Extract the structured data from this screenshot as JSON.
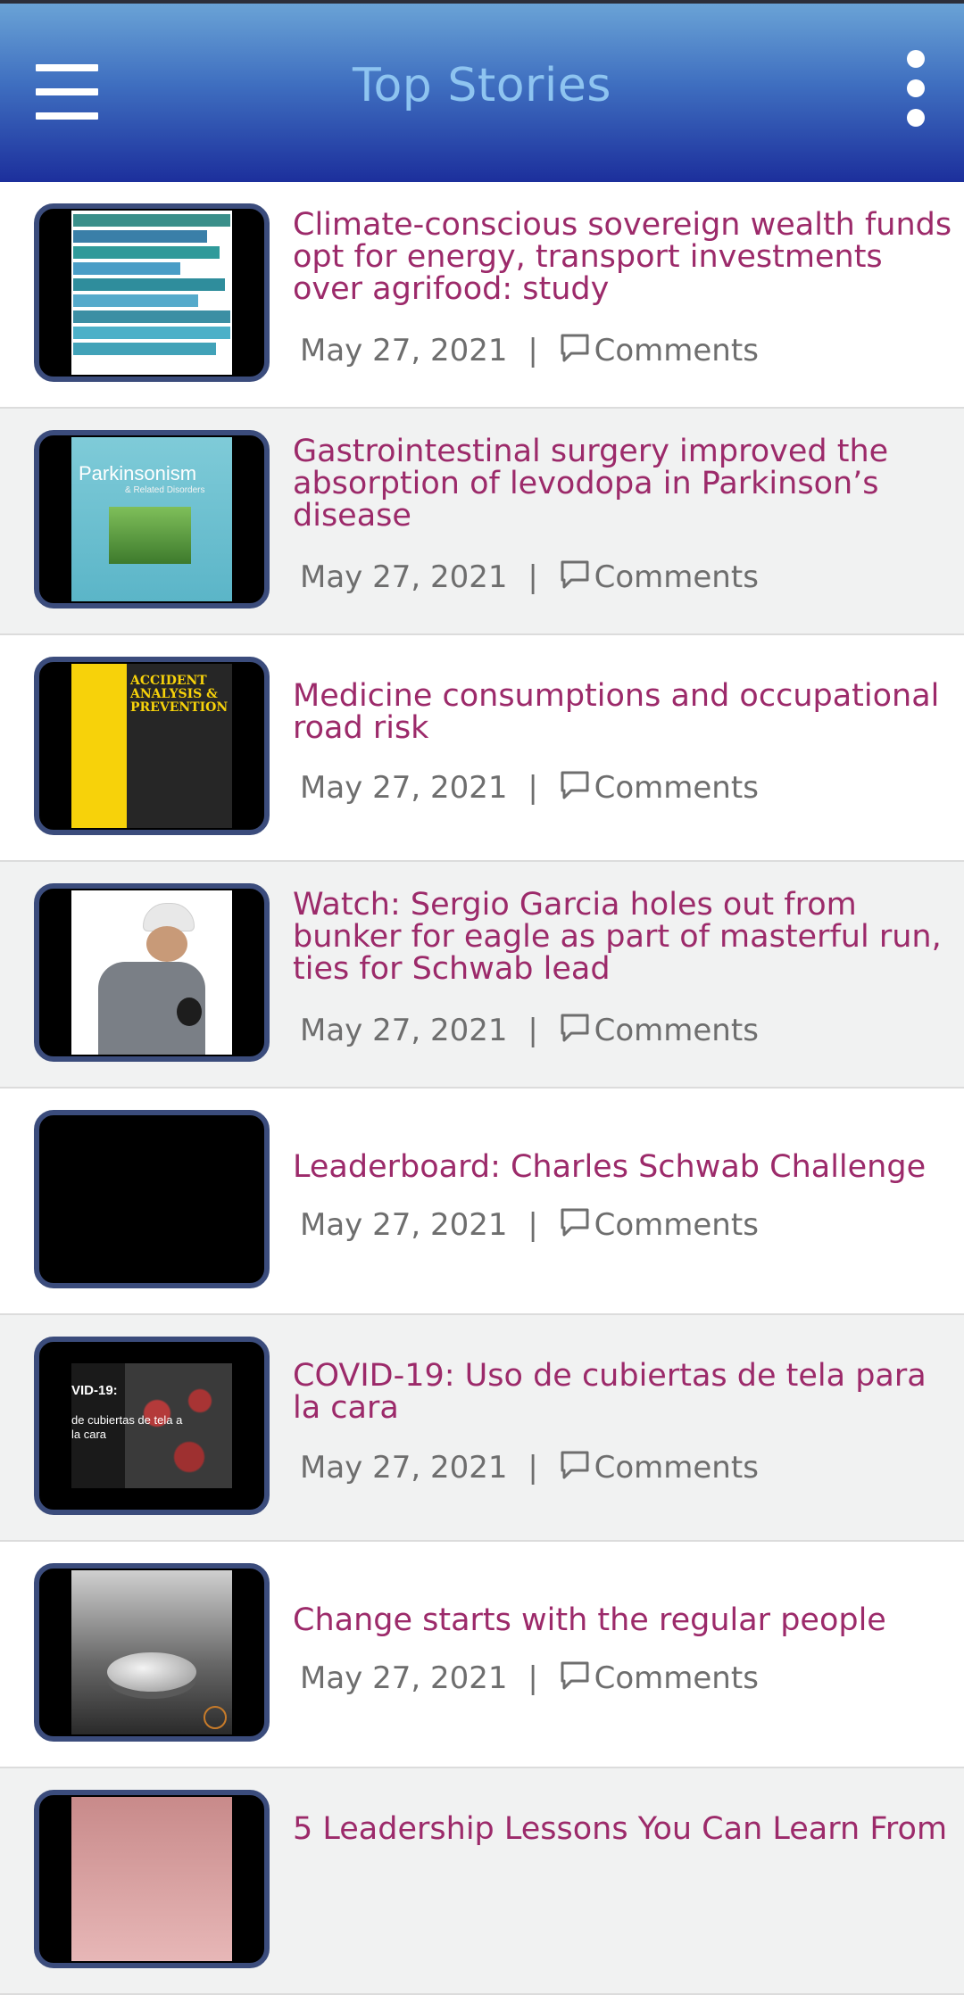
{
  "app_bar": {
    "title": "Top Stories",
    "menu_icon": "hamburger-menu-icon",
    "more_icon": "more-vertical-icon",
    "gradient_top": "#6aa3d6",
    "gradient_bottom": "#1c2f9c",
    "title_color": "#8ec4f0"
  },
  "colors": {
    "title_text": "#9c2a6a",
    "meta_text": "#6e6e6e",
    "thumb_border": "#3b4c7c"
  },
  "stories": [
    {
      "title": "Climate-conscious sovereign wealth funds opt for energy, transport investments over agrifood: study",
      "date": "May 27, 2021",
      "separator": "|",
      "comments_label": "Comments",
      "thumb_icon": "bar-chart-thumbnail"
    },
    {
      "title": "Gastrointestinal surgery improved the absorption of levodopa in Parkinson’s disease",
      "date": "May 27, 2021",
      "separator": "|",
      "comments_label": "Comments",
      "thumb_icon": "journal-cover-thumbnail",
      "thumb_text": "Parkinsonism",
      "thumb_subtext": "& Related Disorders"
    },
    {
      "title": "Medicine consumptions and occupational road risk",
      "date": "May 27, 2021",
      "separator": "|",
      "comments_label": "Comments",
      "thumb_icon": "journal-cover-thumbnail",
      "thumb_text": "ACCIDENT ANALYSIS & PREVENTION"
    },
    {
      "title": "Watch: Sergio Garcia holes out from bunker for eagle as part of masterful run, ties for Schwab lead",
      "date": "May 27, 2021",
      "separator": "|",
      "comments_label": "Comments",
      "thumb_icon": "golfer-photo-thumbnail"
    },
    {
      "title": "Leaderboard: Charles Schwab Challenge",
      "date": "May 27, 2021",
      "separator": "|",
      "comments_label": "Comments",
      "thumb_icon": "blank-thumbnail"
    },
    {
      "title": "COVID-19: Uso de cubiertas de tela para la cara",
      "date": "May 27, 2021",
      "separator": "|",
      "comments_label": "Comments",
      "thumb_icon": "virus-photo-thumbnail",
      "thumb_text": "VID-19:",
      "thumb_subtext": "de cubiertas de tela a la cara"
    },
    {
      "title": "Change starts with the regular people",
      "date": "May 27, 2021",
      "separator": "|",
      "comments_label": "Comments",
      "thumb_icon": "coins-photo-thumbnail"
    },
    {
      "title": "5 Leadership Lessons You Can Learn From",
      "thumb_icon": "leadership-photo-thumbnail"
    }
  ]
}
